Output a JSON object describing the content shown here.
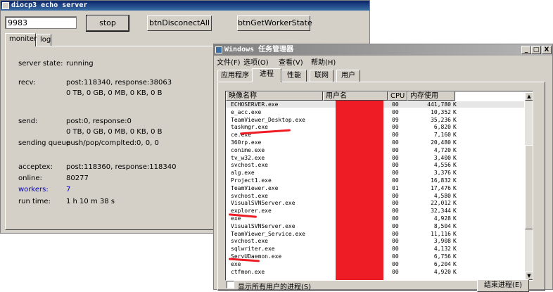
{
  "echo_server": {
    "title": "diocp3 echo server",
    "port_value": "9983",
    "buttons": {
      "stop": "stop",
      "disconnect_all": "btnDisconectAll",
      "get_worker_state": "btnGetWorkerState"
    },
    "tabs": [
      {
        "label": "moniter"
      },
      {
        "label": "log"
      }
    ],
    "stats": {
      "server_state": {
        "label": "server state:",
        "value": "running"
      },
      "recv": {
        "label": "recv:",
        "value1": "post:118340, response:38063",
        "value2": "0 TB, 0 GB, 0 MB, 0 KB, 0 B"
      },
      "send": {
        "label": "send:",
        "value1": "post:0, response:0",
        "value2": "0 TB, 0 GB, 0 MB, 0 KB, 0 B"
      },
      "sending_queue": {
        "label": "sending queue",
        "value": "push/pop/complted:0, 0, 0"
      },
      "acceptex": {
        "label": "acceptex:",
        "value": "post:118360, response:118340"
      },
      "online": {
        "label": "online:",
        "value": "80277"
      },
      "workers": {
        "label": "workers:",
        "value": "7"
      },
      "run_time": {
        "label": "run time:",
        "value": "1 h 10 m 38 s"
      }
    }
  },
  "task_manager": {
    "title": "Windows 任务管理器",
    "window_buttons": {
      "minimize": "_",
      "maximize": "□",
      "close": "X"
    },
    "menu": [
      "文件(F)",
      "选项(O)",
      "查看(V)",
      "帮助(H)"
    ],
    "tabs": [
      "应用程序",
      "进程",
      "性能",
      "联网",
      "用户"
    ],
    "columns": {
      "name": "映像名称",
      "user": "用户名",
      "cpu": "CPU",
      "mem": "内存使用"
    },
    "processes": [
      {
        "name": "ECHOSERVER.exe",
        "cpu": "00",
        "mem": "441,780",
        "unit": "K"
      },
      {
        "name": "e_acc.exe",
        "cpu": "00",
        "mem": "10,352",
        "unit": "K"
      },
      {
        "name": "TeamViewer_Desktop.exe",
        "cpu": "09",
        "mem": "35,236",
        "unit": "K"
      },
      {
        "name": "taskmgr.exe",
        "cpu": "00",
        "mem": "6,820",
        "unit": "K"
      },
      {
        "name": "ce.exe",
        "cpu": "00",
        "mem": "7,160",
        "unit": "K"
      },
      {
        "name": "360rp.exe",
        "cpu": "00",
        "mem": "20,480",
        "unit": "K"
      },
      {
        "name": "conime.exe",
        "cpu": "00",
        "mem": "4,720",
        "unit": "K"
      },
      {
        "name": "tv_w32.exe",
        "cpu": "00",
        "mem": "3,400",
        "unit": "K"
      },
      {
        "name": "svchost.exe",
        "cpu": "00",
        "mem": "4,556",
        "unit": "K"
      },
      {
        "name": "alg.exe",
        "cpu": "00",
        "mem": "3,376",
        "unit": "K"
      },
      {
        "name": "Project1.exe",
        "cpu": "00",
        "mem": "16,832",
        "unit": "K"
      },
      {
        "name": "TeamViewer.exe",
        "cpu": "01",
        "mem": "17,476",
        "unit": "K"
      },
      {
        "name": "svchost.exe",
        "cpu": "00",
        "mem": "4,580",
        "unit": "K"
      },
      {
        "name": "VisualSVNServer.exe",
        "cpu": "00",
        "mem": "22,012",
        "unit": "K"
      },
      {
        "name": "explorer.exe",
        "cpu": "00",
        "mem": "32,344",
        "unit": "K"
      },
      {
        "name": "exe",
        "cpu": "00",
        "mem": "4,928",
        "unit": "K"
      },
      {
        "name": "VisualSVNServer.exe",
        "cpu": "00",
        "mem": "8,504",
        "unit": "K"
      },
      {
        "name": "TeamViewer_Service.exe",
        "cpu": "00",
        "mem": "11,116",
        "unit": "K"
      },
      {
        "name": "svchost.exe",
        "cpu": "00",
        "mem": "3,908",
        "unit": "K"
      },
      {
        "name": "sqlwriter.exe",
        "cpu": "00",
        "mem": "4,132",
        "unit": "K"
      },
      {
        "name": "ServUDaemon.exe",
        "cpu": "00",
        "mem": "6,756",
        "unit": "K"
      },
      {
        "name": "exe",
        "cpu": "00",
        "mem": "6,204",
        "unit": "K"
      },
      {
        "name": "ctfmon.exe",
        "cpu": "00",
        "mem": "4,920",
        "unit": "K"
      }
    ],
    "show_all_users_label": "显示所有用户的进程(S)",
    "end_process_label": "结束进程(E)"
  },
  "colors": {
    "redaction": "#ee1c25",
    "accent_blue": "#0000cc",
    "face": "#d4d0c8"
  }
}
